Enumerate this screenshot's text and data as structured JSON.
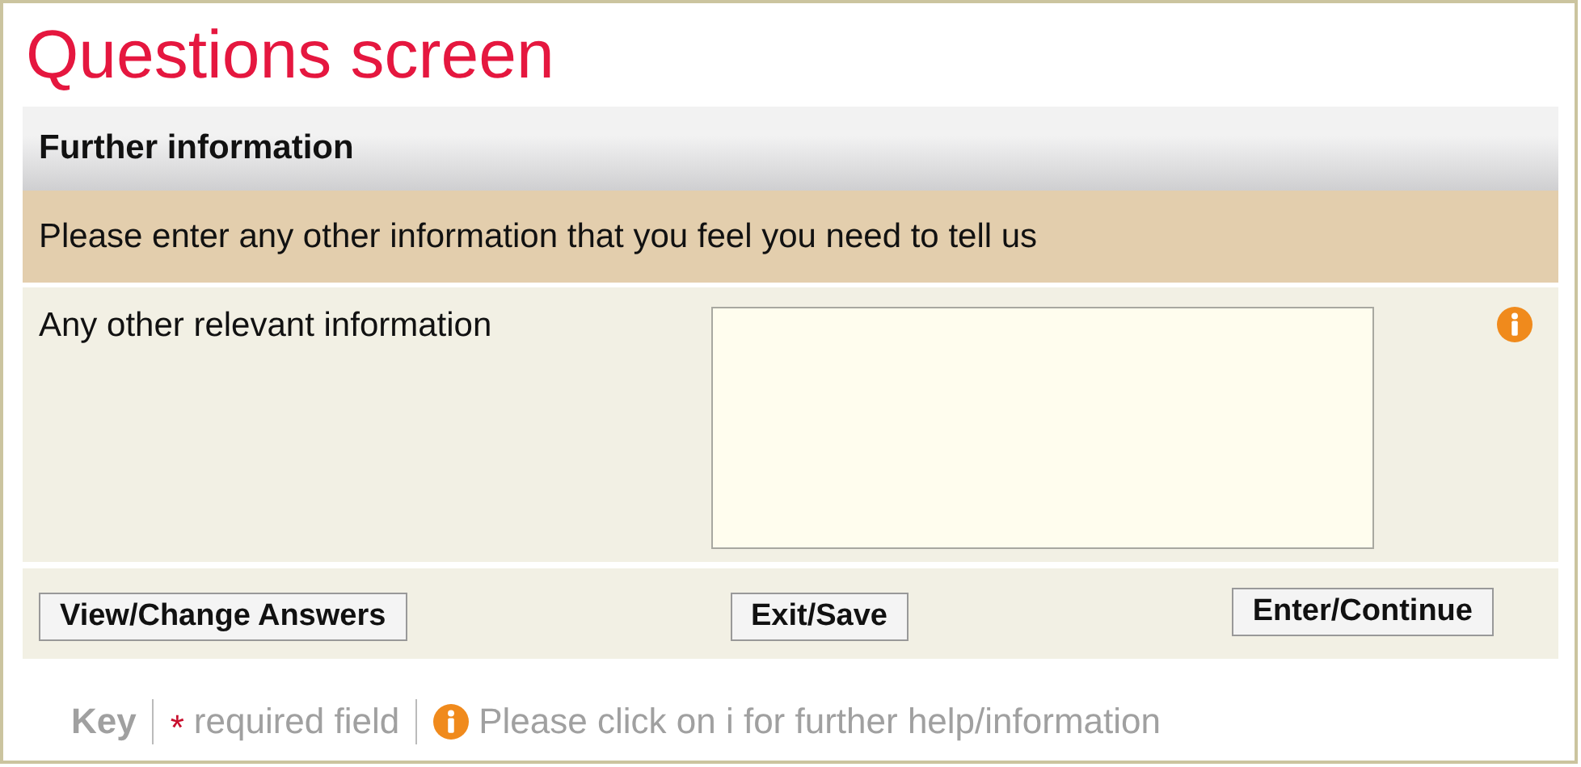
{
  "title": "Questions screen",
  "section": {
    "heading": "Further information",
    "instruction": "Please enter any other information that you feel you need to tell us"
  },
  "question": {
    "label": "Any other relevant information",
    "required": false,
    "has_help": true
  },
  "buttons": [
    "View/Change Answers",
    "Exit/Save",
    "Enter/Continue"
  ],
  "key": {
    "label": "Key",
    "required_mark": "*",
    "required_text": "required field",
    "help_text": "Please click on i for further help/information"
  }
}
